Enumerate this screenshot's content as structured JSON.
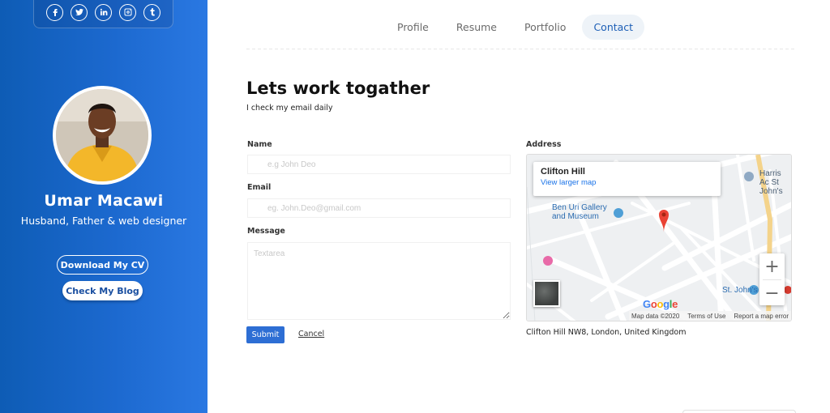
{
  "sidebar": {
    "social": [
      {
        "icon": "facebook-icon"
      },
      {
        "icon": "twitter-icon"
      },
      {
        "icon": "linkedin-icon"
      },
      {
        "icon": "instagram-icon"
      },
      {
        "icon": "tumblr-icon"
      }
    ],
    "name": "Umar Macawi",
    "tagline": "Husband, Father & web designer",
    "download_cv": "Download My CV",
    "check_blog": "Check My Blog"
  },
  "nav": {
    "items": [
      "Profile",
      "Resume",
      "Portfolio",
      "Contact"
    ],
    "active": "Contact"
  },
  "main": {
    "heading": "Lets work togather",
    "subheading": "I check my email daily",
    "form": {
      "name_label": "Name",
      "name_placeholder": "e.g John Deo",
      "email_label": "Email",
      "email_placeholder": "eg. John.Deo@gmail.com",
      "message_label": "Message",
      "message_placeholder": "Textarea",
      "submit": "Submit",
      "cancel": "Cancel"
    },
    "address": {
      "label": "Address",
      "map_title": "Clifton Hill",
      "map_link": "View larger map",
      "poi_gallery": "Ben Uri Gallery and Museum",
      "poi_harris": "Harris Ac St John's",
      "poi_stjohns": "St. John's",
      "google_logo": "Google",
      "footer_data": "Map data ©2020",
      "footer_terms": "Terms of Use",
      "footer_report": "Report a map error",
      "text": "Clifton Hill NW8, London, United Kingdom"
    }
  },
  "colors": {
    "sidebar": "#1c69cf",
    "accent": "#2d6ed4",
    "nav_active": "#1d5fb6"
  }
}
